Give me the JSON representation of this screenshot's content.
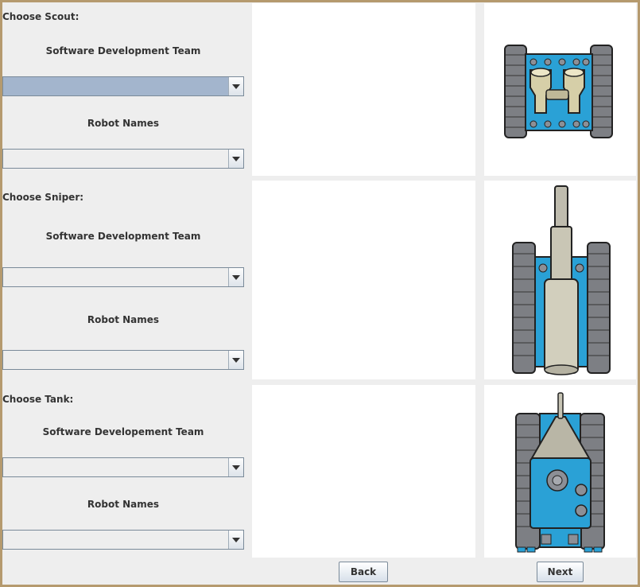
{
  "scout": {
    "heading": "Choose Scout:",
    "team_label": "Software Development Team",
    "names_label": "Robot Names",
    "team_value": "",
    "name_value": ""
  },
  "sniper": {
    "heading": "Choose Sniper:",
    "team_label": "Software Development Team",
    "names_label": "Robot Names",
    "team_value": "",
    "name_value": ""
  },
  "tank": {
    "heading": "Choose Tank:",
    "team_label": "Software Developement Team",
    "names_label": "Robot Names",
    "team_value": "",
    "name_value": ""
  },
  "buttons": {
    "back": "Back",
    "next": "Next"
  },
  "icons": [
    "scout-robot-icon",
    "sniper-robot-icon",
    "tank-robot-icon",
    "combo-arrow-icon"
  ],
  "colors": {
    "frame_border": "#b59a6e",
    "panel_bg": "#eeeeee",
    "robot_blue": "#2aa1d6",
    "selected_field": "#a3b5cd"
  }
}
